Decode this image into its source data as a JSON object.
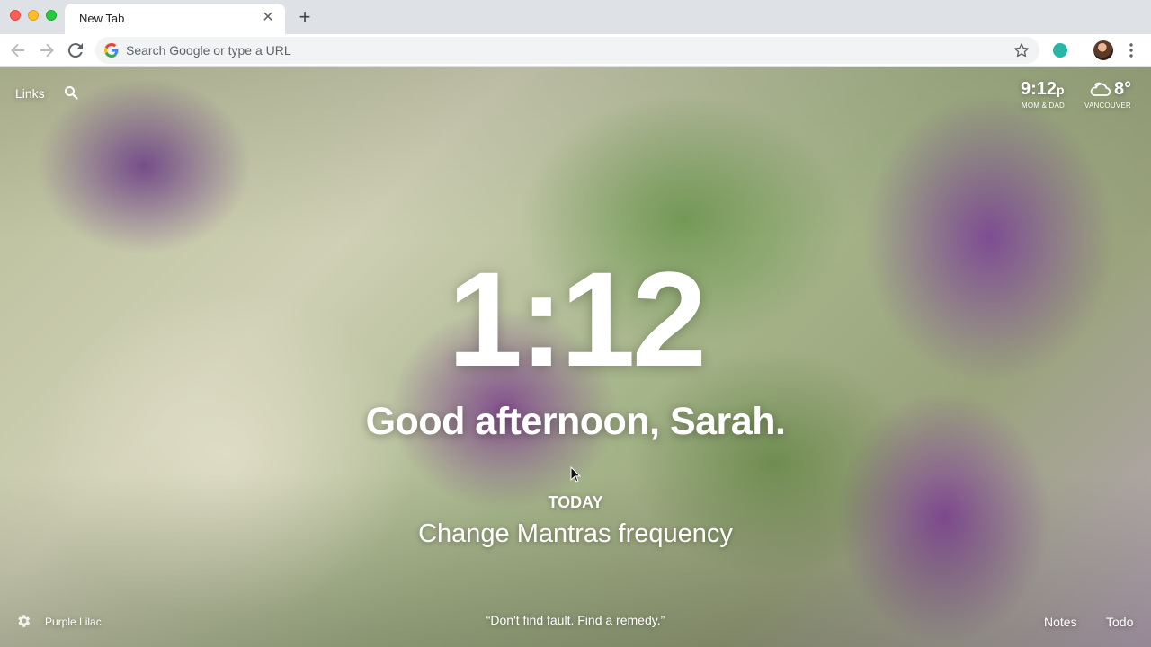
{
  "browser": {
    "tab_title": "New Tab",
    "omnibox_placeholder": "Search Google or type a URL"
  },
  "momentum": {
    "links_label": "Links",
    "world_clock": {
      "time": "9:12",
      "suffix": "p",
      "label": "MOM & DAD"
    },
    "weather": {
      "temp": "8°",
      "location": "VANCOUVER"
    },
    "clock": "1:12",
    "greeting": "Good afternoon, Sarah.",
    "focus": {
      "label": "TODAY",
      "text": "Change Mantras frequency"
    },
    "photo_name": "Purple Lilac",
    "quote": "“Don't find fault. Find a remedy.”",
    "notes_label": "Notes",
    "todo_label": "Todo"
  },
  "colors": {
    "accent_extension": "#26b5a6",
    "tabstrip": "#dee1e6"
  },
  "icons": [
    "back-icon",
    "forward-icon",
    "reload-icon",
    "google-icon",
    "star-icon",
    "extension-icon",
    "avatar",
    "menu-icon",
    "search-icon",
    "cloud-icon",
    "gear-icon"
  ]
}
